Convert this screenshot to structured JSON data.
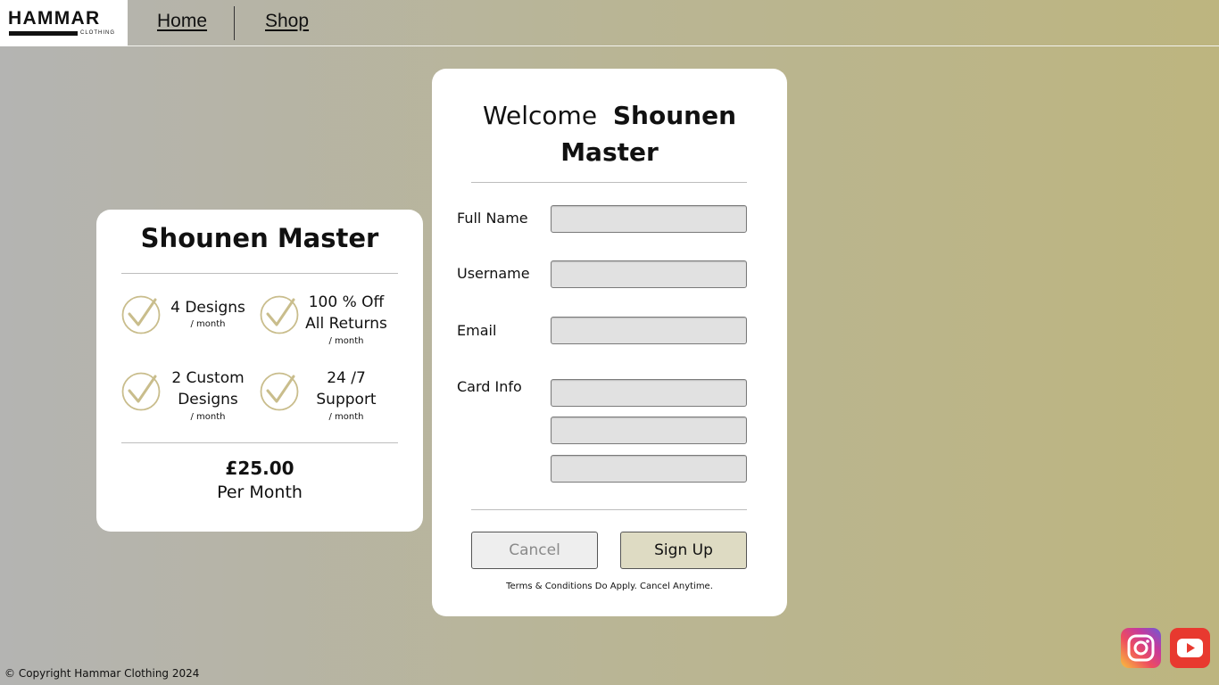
{
  "header": {
    "logo_text": "HAMMAR",
    "logo_subtext": "CLOTHING",
    "nav": [
      {
        "label": "Home"
      },
      {
        "label": "Shop"
      }
    ]
  },
  "plan": {
    "title": "Shounen Master",
    "features": [
      {
        "text": "4 Designs",
        "sub": "/ month",
        "icon": "check-circle-icon"
      },
      {
        "text": "100 % Off All Returns",
        "sub": "/ month",
        "icon": "check-circle-icon"
      },
      {
        "text": "2 Custom Designs",
        "sub": "/ month",
        "icon": "check-circle-icon"
      },
      {
        "text": "24 /7 Support",
        "sub": "/ month",
        "icon": "check-circle-icon"
      }
    ],
    "price": "£25.00",
    "period": "Per Month"
  },
  "signup": {
    "welcome": "Welcome",
    "plan_name": "Shounen Master",
    "fields": [
      {
        "label": "Full Name",
        "value": "",
        "placeholder": ""
      },
      {
        "label": "Username",
        "value": "",
        "placeholder": ""
      },
      {
        "label": "Email",
        "value": "",
        "placeholder": ""
      },
      {
        "label": "Card Info",
        "value": "",
        "placeholder": ""
      }
    ],
    "card_extra_inputs": [
      {
        "value": "",
        "placeholder": ""
      },
      {
        "value": "",
        "placeholder": ""
      }
    ],
    "cancel_label": "Cancel",
    "signup_label": "Sign Up",
    "terms": "Terms & Conditions Do Apply. Cancel Anytime."
  },
  "footer": {
    "copyright": "© Copyright Hammar Clothing 2024",
    "social": [
      {
        "icon": "instagram-icon"
      },
      {
        "icon": "youtube-icon"
      }
    ]
  },
  "colors": {
    "accent_check": "#c9bd8c",
    "signup_button": "#dedbc3",
    "input_bg": "#e1e1e1",
    "youtube_red": "#e8392f"
  }
}
